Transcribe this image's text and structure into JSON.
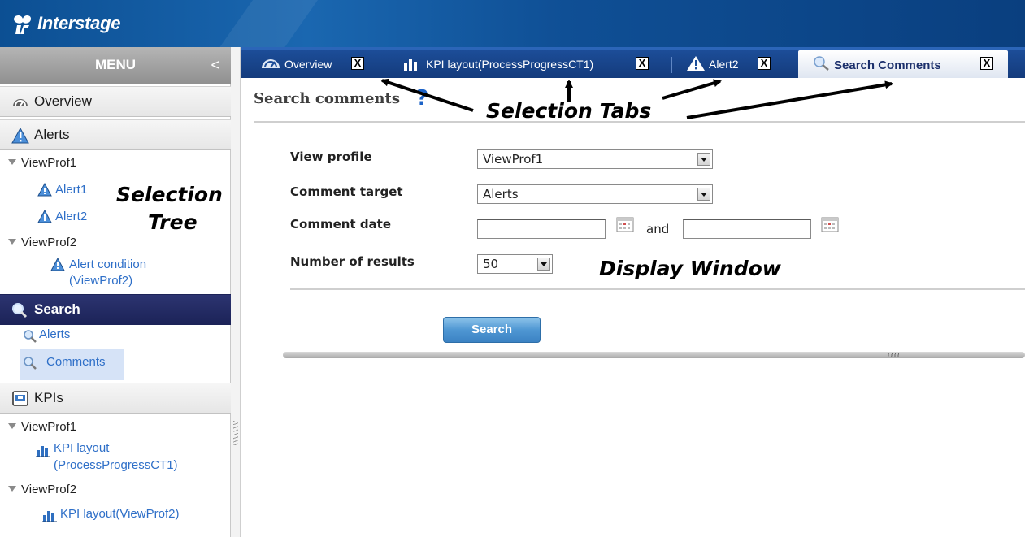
{
  "header": {
    "logo_text": "Interstage"
  },
  "menu": {
    "title": "MENU",
    "collapse_glyph": "<",
    "sections": {
      "overview": "Overview",
      "alerts": "Alerts",
      "search": "Search",
      "kpis": "KPIs"
    },
    "alerts_tree": {
      "profile1": "ViewProf1",
      "alert1": "Alert1",
      "alert2": "Alert2",
      "profile2": "ViewProf2",
      "alert_condition_line1": "Alert condition",
      "alert_condition_line2": "(ViewProf2)"
    },
    "search_tree": {
      "alerts": "Alerts",
      "comments": "Comments"
    },
    "kpi_tree": {
      "profile1": "ViewProf1",
      "kpi1_line1": "KPI layout",
      "kpi1_line2": "(ProcessProgressCT1)",
      "profile2": "ViewProf2",
      "kpi2": "KPI layout(ViewProf2)"
    }
  },
  "tabs": [
    {
      "label": "Overview",
      "close": "X"
    },
    {
      "label": "KPI layout(ProcessProgressCT1)",
      "close": "X"
    },
    {
      "label": "Alert2",
      "close": "X"
    },
    {
      "label": "Search Comments",
      "close": "X"
    }
  ],
  "content": {
    "title": "Search comments",
    "help_glyph": "?",
    "form": {
      "view_profile_label": "View profile",
      "view_profile_value": "ViewProf1",
      "comment_target_label": "Comment target",
      "comment_target_value": "Alerts",
      "comment_date_label": "Comment date",
      "and_text": "and",
      "num_results_label": "Number of results",
      "num_results_value": "50"
    },
    "search_button": "Search"
  },
  "annotations": {
    "selection_tabs": "Selection Tabs",
    "selection_tree_line1": "Selection",
    "selection_tree_line2": "Tree",
    "display_window": "Display Window"
  },
  "colors": {
    "header_blue": "#0c4f93",
    "tab_bar_blue": "#1c4d98",
    "active_section": "#1c2358",
    "link_blue": "#2e6fc8",
    "search_button": "#4f97d3"
  }
}
